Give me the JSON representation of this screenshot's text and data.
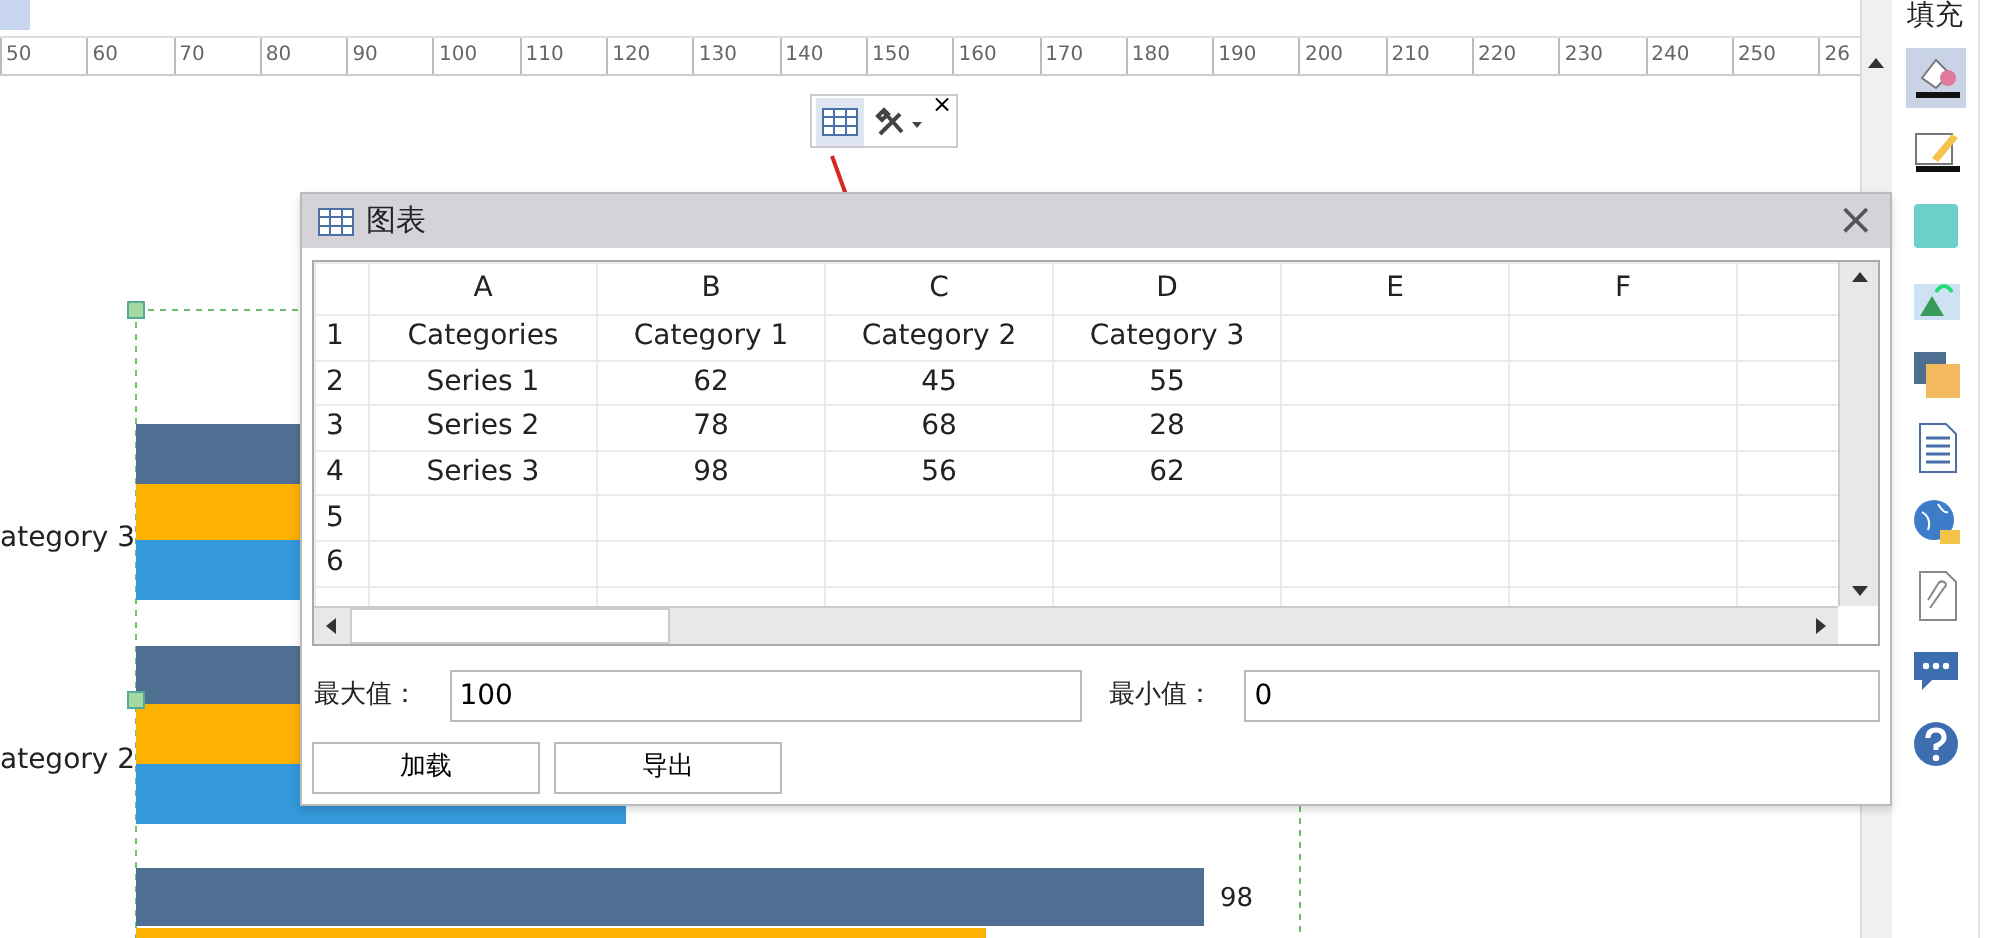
{
  "ruler": {
    "ticks": [
      "50",
      "60",
      "70",
      "80",
      "90",
      "100",
      "110",
      "120",
      "130",
      "140",
      "150",
      "160",
      "170",
      "180",
      "190",
      "200",
      "210",
      "220",
      "230",
      "240",
      "250",
      "26"
    ]
  },
  "chart": {
    "category_labels": [
      "ategory 3",
      "ategory 2"
    ],
    "value_labels": [
      "98"
    ]
  },
  "float_toolbar": {
    "items": [
      {
        "kind": "table",
        "selected": true
      },
      {
        "kind": "tools",
        "selected": false
      }
    ],
    "close": "×"
  },
  "dialog": {
    "title": "图表",
    "close": "×",
    "grid": {
      "columns": [
        "A",
        "B",
        "C",
        "D",
        "E",
        "F"
      ],
      "rows": [
        {
          "number": "1",
          "cells": [
            "Categories",
            "Category 1",
            "Category 2",
            "Category 3"
          ]
        },
        {
          "number": "2",
          "cells": [
            "Series 1",
            "62",
            "45",
            "55"
          ]
        },
        {
          "number": "3",
          "cells": [
            "Series 2",
            "78",
            "68",
            "28"
          ]
        },
        {
          "number": "4",
          "cells": [
            "Series 3",
            "98",
            "56",
            "62"
          ]
        },
        {
          "number": "5"
        },
        {
          "number": "6"
        }
      ]
    },
    "max": {
      "label": "最大值：",
      "value": "100"
    },
    "min": {
      "label": "最小值：",
      "value": "0"
    },
    "buttons": [
      "加载",
      "导出"
    ]
  },
  "side_panel": {
    "title": "填充",
    "icons": [
      {
        "kind": "fill",
        "selected": true
      },
      {
        "kind": "line",
        "selected": false
      },
      {
        "kind": "color",
        "selected": false
      },
      {
        "kind": "image",
        "selected": false
      },
      {
        "kind": "shadow",
        "selected": false
      },
      {
        "kind": "document",
        "selected": false
      },
      {
        "kind": "globe",
        "selected": false
      },
      {
        "kind": "attachment",
        "selected": false
      },
      {
        "kind": "comment",
        "selected": false
      },
      {
        "kind": "help",
        "selected": false
      }
    ]
  }
}
